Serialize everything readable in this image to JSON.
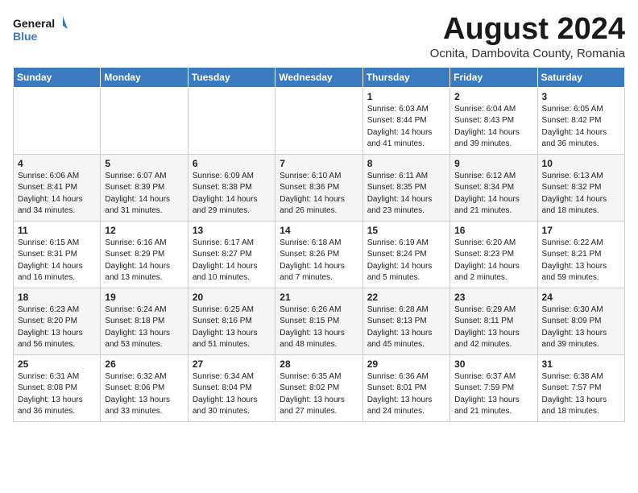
{
  "header": {
    "logo_line1": "General",
    "logo_line2": "Blue",
    "month": "August 2024",
    "location": "Ocnita, Dambovita County, Romania"
  },
  "days_of_week": [
    "Sunday",
    "Monday",
    "Tuesday",
    "Wednesday",
    "Thursday",
    "Friday",
    "Saturday"
  ],
  "weeks": [
    [
      {
        "day": "",
        "info": ""
      },
      {
        "day": "",
        "info": ""
      },
      {
        "day": "",
        "info": ""
      },
      {
        "day": "",
        "info": ""
      },
      {
        "day": "1",
        "info": "Sunrise: 6:03 AM\nSunset: 8:44 PM\nDaylight: 14 hours\nand 41 minutes."
      },
      {
        "day": "2",
        "info": "Sunrise: 6:04 AM\nSunset: 8:43 PM\nDaylight: 14 hours\nand 39 minutes."
      },
      {
        "day": "3",
        "info": "Sunrise: 6:05 AM\nSunset: 8:42 PM\nDaylight: 14 hours\nand 36 minutes."
      }
    ],
    [
      {
        "day": "4",
        "info": "Sunrise: 6:06 AM\nSunset: 8:41 PM\nDaylight: 14 hours\nand 34 minutes."
      },
      {
        "day": "5",
        "info": "Sunrise: 6:07 AM\nSunset: 8:39 PM\nDaylight: 14 hours\nand 31 minutes."
      },
      {
        "day": "6",
        "info": "Sunrise: 6:09 AM\nSunset: 8:38 PM\nDaylight: 14 hours\nand 29 minutes."
      },
      {
        "day": "7",
        "info": "Sunrise: 6:10 AM\nSunset: 8:36 PM\nDaylight: 14 hours\nand 26 minutes."
      },
      {
        "day": "8",
        "info": "Sunrise: 6:11 AM\nSunset: 8:35 PM\nDaylight: 14 hours\nand 23 minutes."
      },
      {
        "day": "9",
        "info": "Sunrise: 6:12 AM\nSunset: 8:34 PM\nDaylight: 14 hours\nand 21 minutes."
      },
      {
        "day": "10",
        "info": "Sunrise: 6:13 AM\nSunset: 8:32 PM\nDaylight: 14 hours\nand 18 minutes."
      }
    ],
    [
      {
        "day": "11",
        "info": "Sunrise: 6:15 AM\nSunset: 8:31 PM\nDaylight: 14 hours\nand 16 minutes."
      },
      {
        "day": "12",
        "info": "Sunrise: 6:16 AM\nSunset: 8:29 PM\nDaylight: 14 hours\nand 13 minutes."
      },
      {
        "day": "13",
        "info": "Sunrise: 6:17 AM\nSunset: 8:27 PM\nDaylight: 14 hours\nand 10 minutes."
      },
      {
        "day": "14",
        "info": "Sunrise: 6:18 AM\nSunset: 8:26 PM\nDaylight: 14 hours\nand 7 minutes."
      },
      {
        "day": "15",
        "info": "Sunrise: 6:19 AM\nSunset: 8:24 PM\nDaylight: 14 hours\nand 5 minutes."
      },
      {
        "day": "16",
        "info": "Sunrise: 6:20 AM\nSunset: 8:23 PM\nDaylight: 14 hours\nand 2 minutes."
      },
      {
        "day": "17",
        "info": "Sunrise: 6:22 AM\nSunset: 8:21 PM\nDaylight: 13 hours\nand 59 minutes."
      }
    ],
    [
      {
        "day": "18",
        "info": "Sunrise: 6:23 AM\nSunset: 8:20 PM\nDaylight: 13 hours\nand 56 minutes."
      },
      {
        "day": "19",
        "info": "Sunrise: 6:24 AM\nSunset: 8:18 PM\nDaylight: 13 hours\nand 53 minutes."
      },
      {
        "day": "20",
        "info": "Sunrise: 6:25 AM\nSunset: 8:16 PM\nDaylight: 13 hours\nand 51 minutes."
      },
      {
        "day": "21",
        "info": "Sunrise: 6:26 AM\nSunset: 8:15 PM\nDaylight: 13 hours\nand 48 minutes."
      },
      {
        "day": "22",
        "info": "Sunrise: 6:28 AM\nSunset: 8:13 PM\nDaylight: 13 hours\nand 45 minutes."
      },
      {
        "day": "23",
        "info": "Sunrise: 6:29 AM\nSunset: 8:11 PM\nDaylight: 13 hours\nand 42 minutes."
      },
      {
        "day": "24",
        "info": "Sunrise: 6:30 AM\nSunset: 8:09 PM\nDaylight: 13 hours\nand 39 minutes."
      }
    ],
    [
      {
        "day": "25",
        "info": "Sunrise: 6:31 AM\nSunset: 8:08 PM\nDaylight: 13 hours\nand 36 minutes."
      },
      {
        "day": "26",
        "info": "Sunrise: 6:32 AM\nSunset: 8:06 PM\nDaylight: 13 hours\nand 33 minutes."
      },
      {
        "day": "27",
        "info": "Sunrise: 6:34 AM\nSunset: 8:04 PM\nDaylight: 13 hours\nand 30 minutes."
      },
      {
        "day": "28",
        "info": "Sunrise: 6:35 AM\nSunset: 8:02 PM\nDaylight: 13 hours\nand 27 minutes."
      },
      {
        "day": "29",
        "info": "Sunrise: 6:36 AM\nSunset: 8:01 PM\nDaylight: 13 hours\nand 24 minutes."
      },
      {
        "day": "30",
        "info": "Sunrise: 6:37 AM\nSunset: 7:59 PM\nDaylight: 13 hours\nand 21 minutes."
      },
      {
        "day": "31",
        "info": "Sunrise: 6:38 AM\nSunset: 7:57 PM\nDaylight: 13 hours\nand 18 minutes."
      }
    ]
  ]
}
